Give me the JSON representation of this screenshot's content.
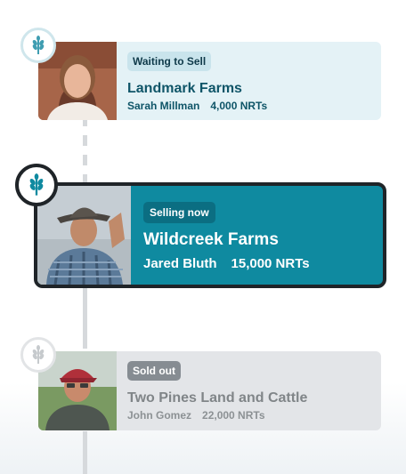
{
  "timeline": [
    {
      "badge": "Waiting to Sell",
      "farm": "Landmark Farms",
      "owner": "Sarah Millman",
      "nrts": "4,000 NRTs",
      "state": "waiting",
      "icon": "wheat-icon"
    },
    {
      "badge": "Selling now",
      "farm": "Wildcreek Farms",
      "owner": "Jared Bluth",
      "nrts": "15,000 NRTs",
      "state": "active",
      "icon": "wheat-icon"
    },
    {
      "badge": "Sold out",
      "farm": "Two Pines Land and Cattle",
      "owner": "John Gomez",
      "nrts": "22,000 NRTs",
      "state": "sold",
      "icon": "wheat-icon"
    }
  ],
  "colors": {
    "accent": "#0f8aa0",
    "waiting_bg": "#e4f2f6",
    "sold_bg": "#e3e5e8",
    "dark": "#1f2428"
  }
}
